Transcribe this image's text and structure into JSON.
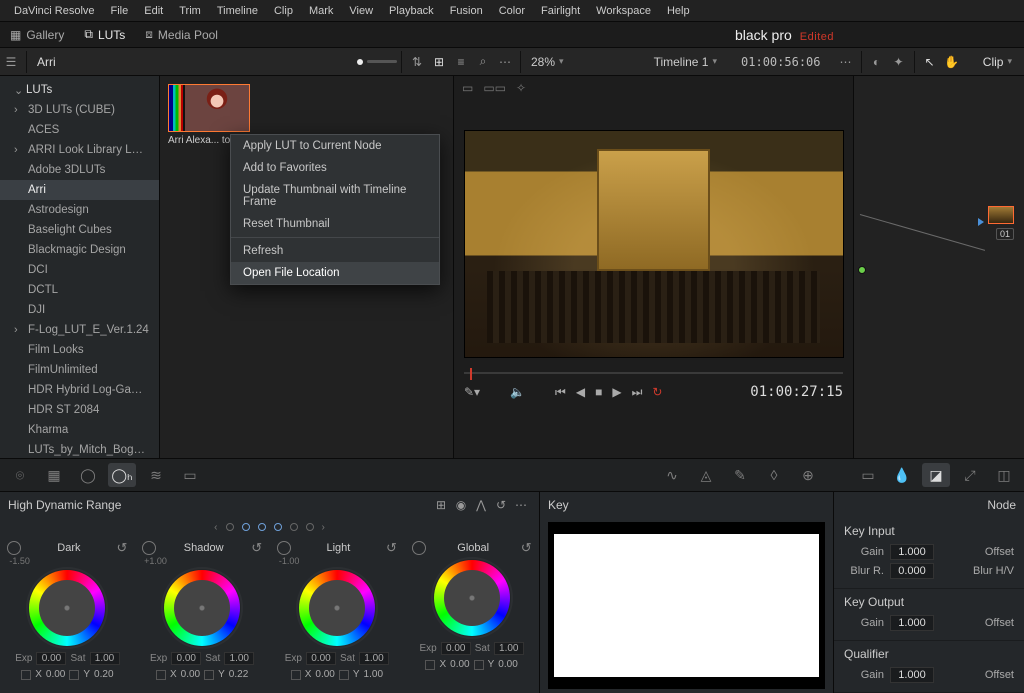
{
  "menubar": [
    "DaVinci Resolve",
    "File",
    "Edit",
    "Trim",
    "Timeline",
    "Clip",
    "Mark",
    "View",
    "Playback",
    "Fusion",
    "Color",
    "Fairlight",
    "Workspace",
    "Help"
  ],
  "panelTabs": {
    "gallery": "Gallery",
    "luts": "LUTs",
    "mediaPool": "Media Pool"
  },
  "project": {
    "name": "black pro",
    "edited": "Edited"
  },
  "toolrow": {
    "breadcrumb": "Arri",
    "zoom": "28%",
    "timeline": "Timeline 1",
    "timecode": "01:00:56:06",
    "clip": "Clip"
  },
  "tree": {
    "root": "LUTs",
    "items": [
      {
        "label": "3D LUTs (CUBE)",
        "hasChild": true
      },
      {
        "label": "ACES"
      },
      {
        "label": "ARRI Look Library Log...",
        "hasChild": true
      },
      {
        "label": "Adobe 3DLUTs"
      },
      {
        "label": "Arri",
        "active": true
      },
      {
        "label": "Astrodesign"
      },
      {
        "label": "Baselight Cubes"
      },
      {
        "label": "Blackmagic Design"
      },
      {
        "label": "DCI"
      },
      {
        "label": "DCTL"
      },
      {
        "label": "DJI"
      },
      {
        "label": "F-Log_LUT_E_Ver.1.24",
        "hasChild": true
      },
      {
        "label": "Film Looks"
      },
      {
        "label": "FilmUnlimited"
      },
      {
        "label": "HDR Hybrid Log-Gamma"
      },
      {
        "label": "HDR ST 2084"
      },
      {
        "label": "Kharma"
      },
      {
        "label": "LUTs_by_Mitch_Bogda..."
      }
    ]
  },
  "thumb": {
    "caption": "Arri Alexa... to"
  },
  "ctxMenu": {
    "items": [
      "Apply LUT to Current Node",
      "Add to Favorites",
      "Update Thumbnail with Timeline Frame",
      "Reset Thumbnail"
    ],
    "items2": [
      "Refresh",
      "Open File Location"
    ],
    "hover": "Open File Location"
  },
  "transport": {
    "tc": "01:00:27:15"
  },
  "nodes": {
    "id": "01"
  },
  "hdr": {
    "title": "High Dynamic Range",
    "wheels": [
      {
        "name": "Dark",
        "offset": "-1.50",
        "exp": "0.00",
        "sat": "1.00",
        "x": "0.00",
        "y": "0.20"
      },
      {
        "name": "Shadow",
        "offset": "+1.00",
        "exp": "0.00",
        "sat": "1.00",
        "x": "0.00",
        "y": "0.22"
      },
      {
        "name": "Light",
        "offset": "-1.00",
        "exp": "0.00",
        "sat": "1.00",
        "x": "0.00",
        "y": "1.00"
      },
      {
        "name": "Global",
        "offset": "",
        "exp": "0.00",
        "sat": "1.00",
        "x": "0.00",
        "y": "0.00"
      }
    ],
    "labels": {
      "exp": "Exp",
      "sat": "Sat",
      "x": "X",
      "y": "Y"
    }
  },
  "key": {
    "title": "Key"
  },
  "rightLower": {
    "nodeTitle": "Node",
    "keyInput": {
      "title": "Key Input",
      "gain": "1.000",
      "offset": "Offset",
      "blurR": "0.000",
      "blurHV": "Blur H/V"
    },
    "keyOutput": {
      "title": "Key Output",
      "gain": "1.000",
      "offset": "Offset"
    },
    "qualifier": {
      "title": "Qualifier",
      "gain": "1.000",
      "offset": "Offset"
    },
    "labels": {
      "gain": "Gain",
      "blurR": "Blur R."
    }
  }
}
